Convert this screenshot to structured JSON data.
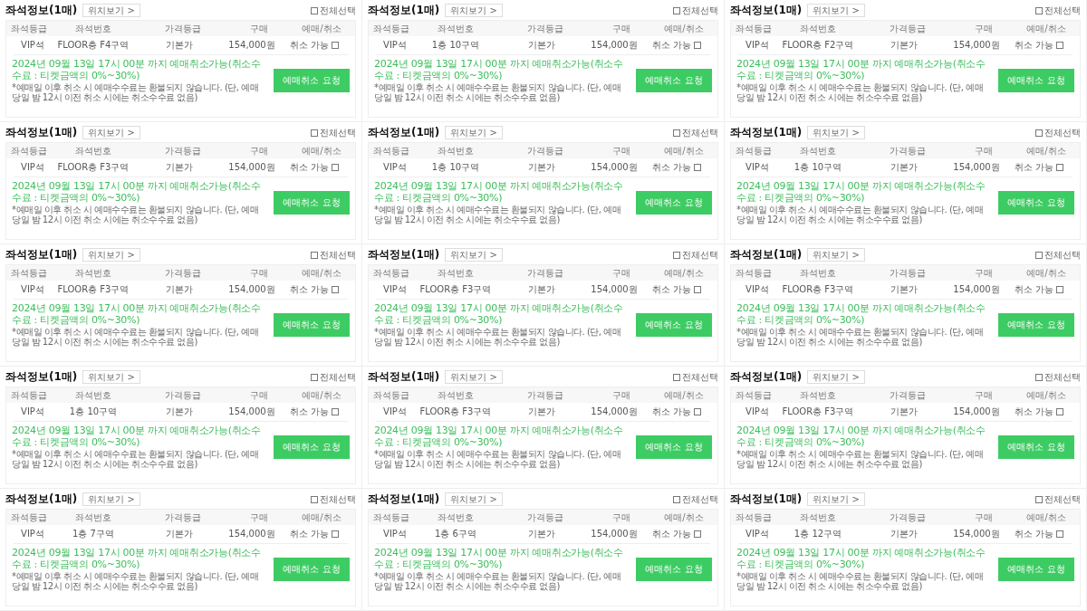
{
  "panels": [
    {
      "title": "좌석정보(1매)",
      "location_button": "위치보기 >",
      "select_all": {
        "label": "전체선택",
        "checked": false
      },
      "columns": [
        "좌석등급",
        "좌석번호",
        "가격등급",
        "구매",
        "예매/취소"
      ],
      "row": {
        "grade": "VIP석",
        "seat": "FLOOR층 F4구역",
        "price_grade": "기본가",
        "price": "154,000원",
        "cancel_label": "취소 가능",
        "checked": false
      },
      "deadline": "2024년 09월 13일 17시 00분 까지 예매취소가능(취소수수료 : 티켓금액의 0%~30%)",
      "note": "*예매일 이후 취소 시 예매수수료는 환불되지 않습니다. (단, 예매 당일 밤 12시 이전 취소 시에는 취소수수료 없음)",
      "cancel_button": "예매취소 요청"
    },
    {
      "title": "좌석정보(1매)",
      "location_button": "위치보기 >",
      "select_all": {
        "label": "전체선택",
        "checked": false
      },
      "columns": [
        "좌석등급",
        "좌석번호",
        "가격등급",
        "구매",
        "예매/취소"
      ],
      "row": {
        "grade": "VIP석",
        "seat": "1층 10구역",
        "price_grade": "기본가",
        "price": "154,000원",
        "cancel_label": "취소 가능",
        "checked": false
      },
      "deadline": "2024년 09월 13일 17시 00분 까지 예매취소가능(취소수수료 : 티켓금액의 0%~30%)",
      "note": "*예매일 이후 취소 시 예매수수료는 환불되지 않습니다. (단, 예매 당일 밤 12시 이전 취소 시에는 취소수수료 없음)",
      "cancel_button": "예매취소 요청"
    },
    {
      "title": "좌석정보(1매)",
      "location_button": "위치보기 >",
      "select_all": {
        "label": "전체선택",
        "checked": false
      },
      "columns": [
        "좌석등급",
        "좌석번호",
        "가격등급",
        "구매",
        "예매/취소"
      ],
      "row": {
        "grade": "VIP석",
        "seat": "FLOOR층 F2구역",
        "price_grade": "기본가",
        "price": "154,000원",
        "cancel_label": "취소 가능",
        "checked": false
      },
      "deadline": "2024년 09월 13일 17시 00분 까지 예매취소가능(취소수수료 : 티켓금액의 0%~30%)",
      "note": "*예매일 이후 취소 시 예매수수료는 환불되지 않습니다. (단, 예매 당일 밤 12시 이전 취소 시에는 취소수수료 없음)",
      "cancel_button": "예매취소 요청"
    },
    {
      "title": "좌석정보(1매)",
      "location_button": "위치보기 >",
      "select_all": {
        "label": "전체선택",
        "checked": false
      },
      "columns": [
        "좌석등급",
        "좌석번호",
        "가격등급",
        "구매",
        "예매/취소"
      ],
      "row": {
        "grade": "VIP석",
        "seat": "FLOOR층 F3구역",
        "price_grade": "기본가",
        "price": "154,000원",
        "cancel_label": "취소 가능",
        "checked": false
      },
      "deadline": "2024년 09월 13일 17시 00분 까지 예매취소가능(취소수수료 : 티켓금액의 0%~30%)",
      "note": "*예매일 이후 취소 시 예매수수료는 환불되지 않습니다. (단, 예매 당일 밤 12시 이전 취소 시에는 취소수수료 없음)",
      "cancel_button": "예매취소 요청"
    },
    {
      "title": "좌석정보(1매)",
      "location_button": "위치보기 >",
      "select_all": {
        "label": "전체선택",
        "checked": false
      },
      "columns": [
        "좌석등급",
        "좌석번호",
        "가격등급",
        "구매",
        "예매/취소"
      ],
      "row": {
        "grade": "VIP석",
        "seat": "1층 10구역",
        "price_grade": "기본가",
        "price": "154,000원",
        "cancel_label": "취소 가능",
        "checked": false
      },
      "deadline": "2024년 09월 13일 17시 00분 까지 예매취소가능(취소수수료 : 티켓금액의 0%~30%)",
      "note": "*예매일 이후 취소 시 예매수수료는 환불되지 않습니다. (단, 예매 당일 밤 12시 이전 취소 시에는 취소수수료 없음)",
      "cancel_button": "예매취소 요청"
    },
    {
      "title": "좌석정보(1매)",
      "location_button": "위치보기 >",
      "select_all": {
        "label": "전체선택",
        "checked": false
      },
      "columns": [
        "좌석등급",
        "좌석번호",
        "가격등급",
        "구매",
        "예매/취소"
      ],
      "row": {
        "grade": "VIP석",
        "seat": "1층 10구역",
        "price_grade": "기본가",
        "price": "154,000원",
        "cancel_label": "취소 가능",
        "checked": false
      },
      "deadline": "2024년 09월 13일 17시 00분 까지 예매취소가능(취소수수료 : 티켓금액의 0%~30%)",
      "note": "*예매일 이후 취소 시 예매수수료는 환불되지 않습니다. (단, 예매 당일 밤 12시 이전 취소 시에는 취소수수료 없음)",
      "cancel_button": "예매취소 요청"
    },
    {
      "title": "좌석정보(1매)",
      "location_button": "위치보기 >",
      "select_all": {
        "label": "전체선택",
        "checked": false
      },
      "columns": [
        "좌석등급",
        "좌석번호",
        "가격등급",
        "구매",
        "예매/취소"
      ],
      "row": {
        "grade": "VIP석",
        "seat": "FLOOR층 F3구역",
        "price_grade": "기본가",
        "price": "154,000원",
        "cancel_label": "취소 가능",
        "checked": false
      },
      "deadline": "2024년 09월 13일 17시 00분 까지 예매취소가능(취소수수료 : 티켓금액의 0%~30%)",
      "note": "*예매일 이후 취소 시 예매수수료는 환불되지 않습니다. (단, 예매 당일 밤 12시 이전 취소 시에는 취소수수료 없음)",
      "cancel_button": "예매취소 요청"
    },
    {
      "title": "좌석정보(1매)",
      "location_button": "위치보기 >",
      "select_all": {
        "label": "전체선택",
        "checked": false
      },
      "columns": [
        "좌석등급",
        "좌석번호",
        "가격등급",
        "구매",
        "예매/취소"
      ],
      "row": {
        "grade": "VIP석",
        "seat": "FLOOR층 F3구역",
        "price_grade": "기본가",
        "price": "154,000원",
        "cancel_label": "취소 가능",
        "checked": false
      },
      "deadline": "2024년 09월 13일 17시 00분 까지 예매취소가능(취소수수료 : 티켓금액의 0%~30%)",
      "note": "*예매일 이후 취소 시 예매수수료는 환불되지 않습니다. (단, 예매 당일 밤 12시 이전 취소 시에는 취소수수료 없음)",
      "cancel_button": "예매취소 요청"
    },
    {
      "title": "좌석정보(1매)",
      "location_button": "위치보기 >",
      "select_all": {
        "label": "전체선택",
        "checked": false
      },
      "columns": [
        "좌석등급",
        "좌석번호",
        "가격등급",
        "구매",
        "예매/취소"
      ],
      "row": {
        "grade": "VIP석",
        "seat": "FLOOR층 F3구역",
        "price_grade": "기본가",
        "price": "154,000원",
        "cancel_label": "취소 가능",
        "checked": false
      },
      "deadline": "2024년 09월 13일 17시 00분 까지 예매취소가능(취소수수료 : 티켓금액의 0%~30%)",
      "note": "*예매일 이후 취소 시 예매수수료는 환불되지 않습니다. (단, 예매 당일 밤 12시 이전 취소 시에는 취소수수료 없음)",
      "cancel_button": "예매취소 요청"
    },
    {
      "title": "좌석정보(1매)",
      "location_button": "위치보기 >",
      "select_all": {
        "label": "전체선택",
        "checked": false
      },
      "columns": [
        "좌석등급",
        "좌석번호",
        "가격등급",
        "구매",
        "예매/취소"
      ],
      "row": {
        "grade": "VIP석",
        "seat": "1층 10구역",
        "price_grade": "기본가",
        "price": "154,000원",
        "cancel_label": "취소 가능",
        "checked": false
      },
      "deadline": "2024년 09월 13일 17시 00분 까지 예매취소가능(취소수수료 : 티켓금액의 0%~30%)",
      "note": "*예매일 이후 취소 시 예매수수료는 환불되지 않습니다. (단, 예매 당일 밤 12시 이전 취소 시에는 취소수수료 없음)",
      "cancel_button": "예매취소 요청"
    },
    {
      "title": "좌석정보(1매)",
      "location_button": "위치보기 >",
      "select_all": {
        "label": "전체선택",
        "checked": false
      },
      "columns": [
        "좌석등급",
        "좌석번호",
        "가격등급",
        "구매",
        "예매/취소"
      ],
      "row": {
        "grade": "VIP석",
        "seat": "FLOOR층 F3구역",
        "price_grade": "기본가",
        "price": "154,000원",
        "cancel_label": "취소 가능",
        "checked": false
      },
      "deadline": "2024년 09월 13일 17시 00분 까지 예매취소가능(취소수수료 : 티켓금액의 0%~30%)",
      "note": "*예매일 이후 취소 시 예매수수료는 환불되지 않습니다. (단, 예매 당일 밤 12시 이전 취소 시에는 취소수수료 없음)",
      "cancel_button": "예매취소 요청"
    },
    {
      "title": "좌석정보(1매)",
      "location_button": "위치보기 >",
      "select_all": {
        "label": "전체선택",
        "checked": false
      },
      "columns": [
        "좌석등급",
        "좌석번호",
        "가격등급",
        "구매",
        "예매/취소"
      ],
      "row": {
        "grade": "VIP석",
        "seat": "FLOOR층 F3구역",
        "price_grade": "기본가",
        "price": "154,000원",
        "cancel_label": "취소 가능",
        "checked": false
      },
      "deadline": "2024년 09월 13일 17시 00분 까지 예매취소가능(취소수수료 : 티켓금액의 0%~30%)",
      "note": "*예매일 이후 취소 시 예매수수료는 환불되지 않습니다. (단, 예매 당일 밤 12시 이전 취소 시에는 취소수수료 없음)",
      "cancel_button": "예매취소 요청"
    },
    {
      "title": "좌석정보(1매)",
      "location_button": "위치보기 >",
      "select_all": {
        "label": "전체선택",
        "checked": false
      },
      "columns": [
        "좌석등급",
        "좌석번호",
        "가격등급",
        "구매",
        "예매/취소"
      ],
      "row": {
        "grade": "VIP석",
        "seat": "1층 7구역",
        "price_grade": "기본가",
        "price": "154,000원",
        "cancel_label": "취소 가능",
        "checked": false
      },
      "deadline": "2024년 09월 13일 17시 00분 까지 예매취소가능(취소수수료 : 티켓금액의 0%~30%)",
      "note": "*예매일 이후 취소 시 예매수수료는 환불되지 않습니다. (단, 예매 당일 밤 12시 이전 취소 시에는 취소수수료 없음)",
      "cancel_button": "예매취소 요청"
    },
    {
      "title": "좌석정보(1매)",
      "location_button": "위치보기 >",
      "select_all": {
        "label": "전체선택",
        "checked": false
      },
      "columns": [
        "좌석등급",
        "좌석번호",
        "가격등급",
        "구매",
        "예매/취소"
      ],
      "row": {
        "grade": "VIP석",
        "seat": "1층 6구역",
        "price_grade": "기본가",
        "price": "154,000원",
        "cancel_label": "취소 가능",
        "checked": false
      },
      "deadline": "2024년 09월 13일 17시 00분 까지 예매취소가능(취소수수료 : 티켓금액의 0%~30%)",
      "note": "*예매일 이후 취소 시 예매수수료는 환불되지 않습니다. (단, 예매 당일 밤 12시 이전 취소 시에는 취소수수료 없음)",
      "cancel_button": "예매취소 요청"
    },
    {
      "title": "좌석정보(1매)",
      "location_button": "위치보기 >",
      "select_all": {
        "label": "전체선택",
        "checked": false
      },
      "columns": [
        "좌석등급",
        "좌석번호",
        "가격등급",
        "구매",
        "예매/취소"
      ],
      "row": {
        "grade": "VIP석",
        "seat": "1층 12구역",
        "price_grade": "기본가",
        "price": "154,000원",
        "cancel_label": "취소 가능",
        "checked": false
      },
      "deadline": "2024년 09월 13일 17시 00분 까지 예매취소가능(취소수수료 : 티켓금액의 0%~30%)",
      "note": "*예매일 이후 취소 시 예매수수료는 환불되지 않습니다. (단, 예매 당일 밤 12시 이전 취소 시에는 취소수수료 없음)",
      "cancel_button": "예매취소 요청"
    }
  ]
}
